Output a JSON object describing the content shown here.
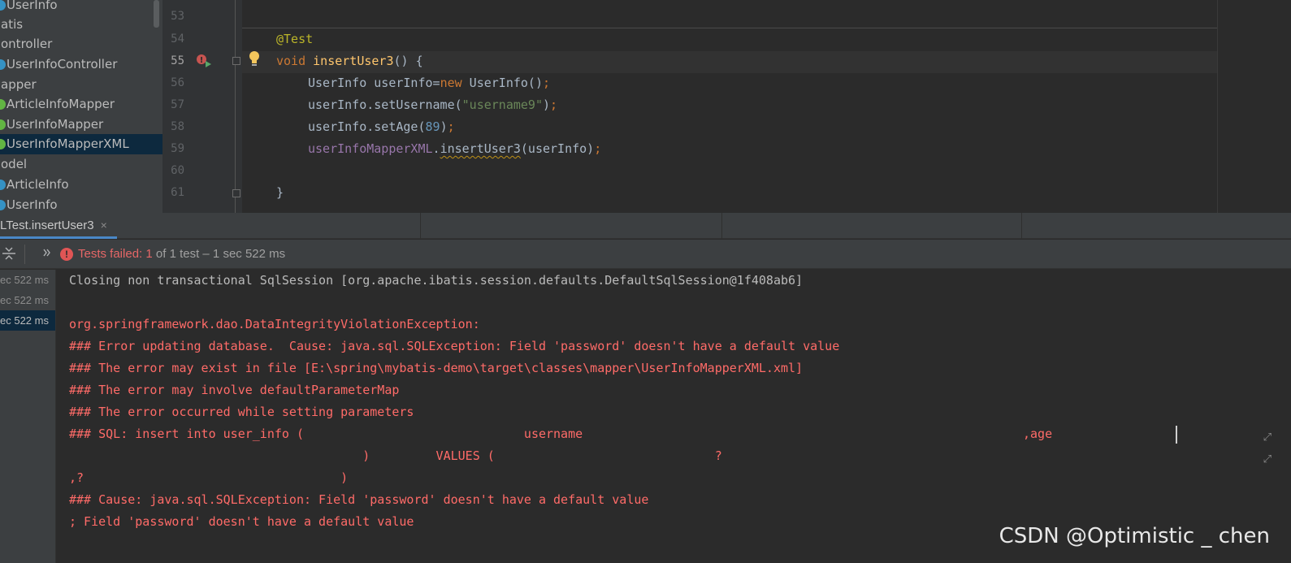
{
  "project_tree": {
    "items": [
      {
        "label": "UserInfo",
        "icon": "class-icon"
      },
      {
        "label": "atis",
        "icon": ""
      },
      {
        "label": "ontroller",
        "icon": ""
      },
      {
        "label": "UserInfoController",
        "icon": "class-icon"
      },
      {
        "label": "apper",
        "icon": ""
      },
      {
        "label": "ArticleInfoMapper",
        "icon": "interface-icon"
      },
      {
        "label": "UserInfoMapper",
        "icon": "interface-icon"
      },
      {
        "label": "UserInfoMapperXML",
        "icon": "interface-icon"
      },
      {
        "label": "odel",
        "icon": ""
      },
      {
        "label": "ArticleInfo",
        "icon": "class-icon"
      },
      {
        "label": "UserInfo",
        "icon": "class-icon"
      }
    ]
  },
  "editor": {
    "line_numbers": [
      "53",
      "54",
      "55",
      "56",
      "57",
      "58",
      "59",
      "60",
      "61"
    ],
    "current_line": "55",
    "code": {
      "l54_annotation": "@Test",
      "l55_void": "void",
      "l55_name": "insertUser3",
      "l55_rest": "() {",
      "l56_type": "UserInfo userInfo=",
      "l56_new": "new",
      "l56_ctor": " UserInfo()",
      "l56_semi": ";",
      "l57_call": "userInfo.setUsername(",
      "l57_str": "\"username9\"",
      "l57_end": ")",
      "l57_semi": ";",
      "l58_call": "userInfo.setAge(",
      "l58_num": "89",
      "l58_end": ")",
      "l58_semi": ";",
      "l59_field": "userInfoMapperXML",
      "l59_dot": ".",
      "l59_method": "insertUser3",
      "l59_args": "(userInfo)",
      "l59_semi": ";",
      "l61_brace": "}"
    }
  },
  "run_tab": {
    "label": "LTest.insertUser3",
    "close": "×"
  },
  "test_toolbar": {
    "status_failed": "Tests failed: 1",
    "status_rest": " of 1 test – 1 sec 522 ms"
  },
  "test_tree": {
    "rows": [
      "ec 522 ms",
      "ec 522 ms",
      "ec 522 ms"
    ]
  },
  "console": {
    "lines": [
      {
        "text": "Closing non transactional SqlSession [org.apache.ibatis.session.defaults.DefaultSqlSession@1f408ab6]",
        "kind": "std"
      },
      {
        "text": "",
        "kind": "std"
      },
      {
        "text": "org.springframework.dao.DataIntegrityViolationException:",
        "kind": "err"
      },
      {
        "text": "### Error updating database.  Cause: java.sql.SQLException: Field 'password' doesn't have a default value",
        "kind": "err"
      },
      {
        "text": "### The error may exist in file [E:\\spring\\mybatis-demo\\target\\classes\\mapper\\UserInfoMapperXML.xml]",
        "kind": "err"
      },
      {
        "text": "### The error may involve defaultParameterMap",
        "kind": "err"
      },
      {
        "text": "### The error occurred while setting parameters",
        "kind": "err"
      },
      {
        "text": "### SQL: insert into user_info (                              username                                                            ,age",
        "kind": "err"
      },
      {
        "text": "                                        )         VALUES (                              ?",
        "kind": "err"
      },
      {
        "text": ",?                                   )",
        "kind": "err"
      },
      {
        "text": "### Cause: java.sql.SQLException: Field 'password' doesn't have a default value",
        "kind": "err"
      },
      {
        "text": "; Field 'password' doesn't have a default value",
        "kind": "err"
      }
    ]
  },
  "watermark": "CSDN @Optimistic _ chen"
}
